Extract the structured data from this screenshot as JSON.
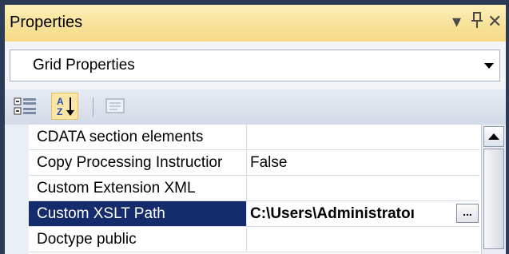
{
  "window": {
    "title": "Properties",
    "buttons": {
      "dropdown_glyph": "▾",
      "pin_glyph": "ᵖ",
      "close_glyph": "✕"
    }
  },
  "object_selector": {
    "value": "Grid Properties"
  },
  "toolbar": {
    "items": [
      {
        "name": "categorized",
        "icon": "categorized-view-icon",
        "active": false
      },
      {
        "name": "alphabetical",
        "icon": "sort-az-icon",
        "active": true
      },
      {
        "name": "property-pages",
        "icon": "property-pages-icon",
        "active": false,
        "disabled": true
      }
    ]
  },
  "properties": [
    {
      "name": "CDATA section elements",
      "value": ""
    },
    {
      "name": "Copy Processing Instructior",
      "value": "False"
    },
    {
      "name": "Custom Extension XML",
      "value": ""
    },
    {
      "name": "Custom XSLT Path",
      "value": "C:\\Users\\Administratoı",
      "selected": true,
      "ellipsis": "..."
    },
    {
      "name": "Doctype public",
      "value": ""
    }
  ],
  "colors": {
    "title_gradient_top": "#fcefb8",
    "title_gradient_bottom": "#f5d983",
    "selected_row": "#142c6b",
    "frame": "#2b3a55"
  }
}
